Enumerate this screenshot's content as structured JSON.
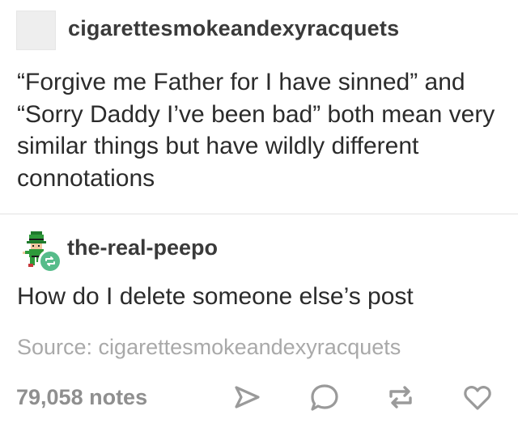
{
  "original_post": {
    "username": "cigarettesmokeandexyracquets",
    "text": "“Forgive me Father for I have sinned” and “Sorry Daddy I’ve been bad” both mean very similar things but have wildly different connotations"
  },
  "reblog": {
    "username": "the-real-peepo",
    "text": "How do I delete someone else’s post",
    "avatar_icon": "pixel-leprechaun-avatar",
    "badge_icon": "reblog-badge-icon"
  },
  "footer": {
    "source_label": "Source: cigarettesmokeandexyracquets",
    "notes": "79,058 notes",
    "actions": [
      "share-icon",
      "reply-icon",
      "reblog-icon",
      "heart-icon"
    ]
  },
  "colors": {
    "text": "#2b2b2b",
    "muted": "#a9a9a9",
    "reblog_badge": "#56bc8a",
    "leprechaun_green": "#2e9a3a"
  }
}
